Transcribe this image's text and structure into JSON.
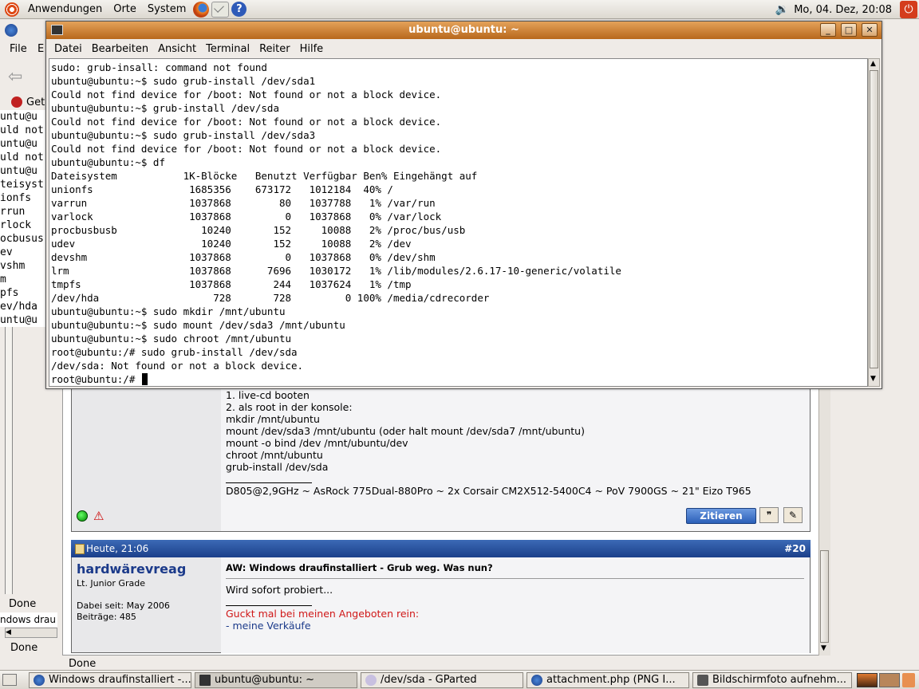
{
  "top_panel": {
    "menus": [
      "Anwendungen",
      "Orte",
      "System"
    ],
    "clock": "Mo, 04. Dez, 20:08"
  },
  "browser": {
    "menu_left": [
      "File",
      "E"
    ],
    "toolbar_partial": "Get",
    "status_texts": [
      "Done",
      "Done",
      "Done"
    ],
    "partial_tab_text": "ndows drau",
    "left_terminal_peek": [
      "untu@u",
      "uld not",
      "untu@u",
      "uld not",
      "untu@u",
      "teisyst",
      "ionfs",
      "rrun",
      "rlock",
      "ocbusus",
      "ev",
      "vshm",
      "m",
      "pfs",
      "ev/hda",
      "untu@u"
    ],
    "post1": {
      "lines": [
        "1. live-cd booten",
        "2. als root in der konsole:",
        "mkdir /mnt/ubuntu",
        "mount /dev/sda3 /mnt/ubuntu (oder halt mount /dev/sda7 /mnt/ubuntu)",
        "mount -o bind /dev /mnt/ubuntu/dev",
        "chroot /mnt/ubuntu",
        "grub-install /dev/sda"
      ],
      "signature": "D805@2,9GHz ~ AsRock 775Dual-880Pro ~ 2x Corsair CM2X512-5400C4 ~ PoV 7900GS ~ 21\" Eizo T965",
      "quote_button": "Zitieren"
    },
    "post2": {
      "date": "Heute, 21:06",
      "number": "#20",
      "author": "hardwärevreag",
      "rank": "Lt. Junior Grade",
      "joined": "Dabei seit: May 2006",
      "posts": "Beiträge: 485",
      "title": "AW: Windows draufinstalliert - Grub weg. Was nun?",
      "body": "Wird sofort probiert...",
      "sig_line1": "Guckt mal bei meinen Angeboten rein:",
      "sig_line2": "- meine Verkäufe"
    }
  },
  "terminal": {
    "title": "ubuntu@ubuntu: ~",
    "menus": [
      "Datei",
      "Bearbeiten",
      "Ansicht",
      "Terminal",
      "Reiter",
      "Hilfe"
    ],
    "lines": [
      "sudo: grub-insall: command not found",
      "ubuntu@ubuntu:~$ sudo grub-install /dev/sda1",
      "Could not find device for /boot: Not found or not a block device.",
      "ubuntu@ubuntu:~$ grub-install /dev/sda",
      "Could not find device for /boot: Not found or not a block device.",
      "ubuntu@ubuntu:~$ sudo grub-install /dev/sda3",
      "Could not find device for /boot: Not found or not a block device.",
      "ubuntu@ubuntu:~$ df",
      "Dateisystem           1K-Blöcke   Benutzt Verfügbar Ben% Eingehängt auf",
      "unionfs                1685356    673172   1012184  40% /",
      "varrun                 1037868        80   1037788   1% /var/run",
      "varlock                1037868         0   1037868   0% /var/lock",
      "procbusbusb              10240       152     10088   2% /proc/bus/usb",
      "udev                     10240       152     10088   2% /dev",
      "devshm                 1037868         0   1037868   0% /dev/shm",
      "lrm                    1037868      7696   1030172   1% /lib/modules/2.6.17-10-generic/volatile",
      "tmpfs                  1037868       244   1037624   1% /tmp",
      "/dev/hda                   728       728         0 100% /media/cdrecorder",
      "ubuntu@ubuntu:~$ sudo mkdir /mnt/ubuntu",
      "ubuntu@ubuntu:~$ sudo mount /dev/sda3 /mnt/ubuntu",
      "ubuntu@ubuntu:~$ sudo chroot /mnt/ubuntu",
      "root@ubuntu:/# sudo grub-install /dev/sda",
      "/dev/sda: Not found or not a block device.",
      "root@ubuntu:/# "
    ]
  },
  "taskbar": {
    "tasks": [
      "Windows draufinstalliert -...",
      "ubuntu@ubuntu: ~",
      "/dev/sda - GParted",
      "attachment.php (PNG I...",
      "Bildschirmfoto aufnehm..."
    ]
  }
}
